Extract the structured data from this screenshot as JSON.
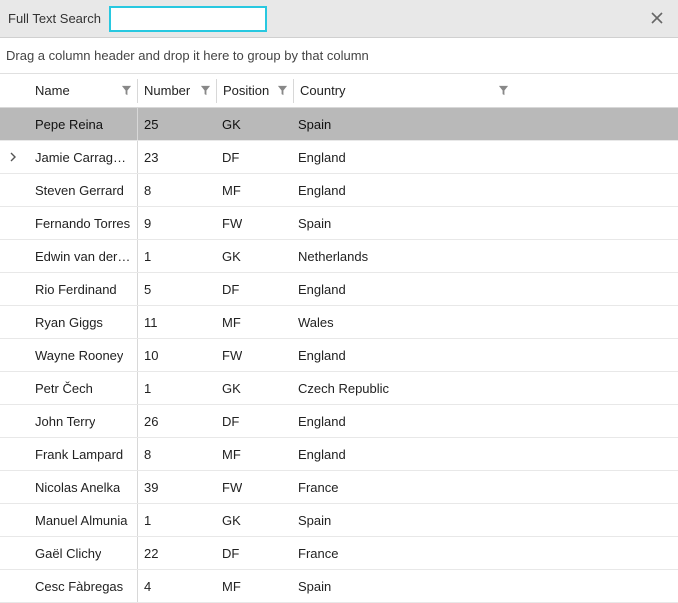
{
  "search": {
    "label": "Full Text Search",
    "value": "",
    "placeholder": ""
  },
  "groupArea": {
    "hint": "Drag a column header and drop it here to group by that column"
  },
  "columns": [
    {
      "key": "name",
      "label": "Name"
    },
    {
      "key": "number",
      "label": "Number"
    },
    {
      "key": "position",
      "label": "Position"
    },
    {
      "key": "country",
      "label": "Country"
    }
  ],
  "rows": [
    {
      "name": "Pepe Reina",
      "number": "25",
      "position": "GK",
      "country": "Spain",
      "selected": true,
      "expandable": false
    },
    {
      "name": "Jamie Carragher",
      "number": "23",
      "position": "DF",
      "country": "England",
      "selected": false,
      "expandable": true
    },
    {
      "name": "Steven Gerrard",
      "number": "8",
      "position": "MF",
      "country": "England",
      "selected": false,
      "expandable": false
    },
    {
      "name": "Fernando Torres",
      "number": "9",
      "position": "FW",
      "country": "Spain",
      "selected": false,
      "expandable": false
    },
    {
      "name": "Edwin van der Sar",
      "number": "1",
      "position": "GK",
      "country": "Netherlands",
      "selected": false,
      "expandable": false
    },
    {
      "name": "Rio Ferdinand",
      "number": "5",
      "position": "DF",
      "country": "England",
      "selected": false,
      "expandable": false
    },
    {
      "name": "Ryan Giggs",
      "number": "11",
      "position": "MF",
      "country": "Wales",
      "selected": false,
      "expandable": false
    },
    {
      "name": "Wayne Rooney",
      "number": "10",
      "position": "FW",
      "country": "England",
      "selected": false,
      "expandable": false
    },
    {
      "name": "Petr Čech",
      "number": "1",
      "position": "GK",
      "country": "Czech Republic",
      "selected": false,
      "expandable": false
    },
    {
      "name": "John Terry",
      "number": "26",
      "position": "DF",
      "country": "England",
      "selected": false,
      "expandable": false
    },
    {
      "name": "Frank Lampard",
      "number": "8",
      "position": "MF",
      "country": "England",
      "selected": false,
      "expandable": false
    },
    {
      "name": "Nicolas Anelka",
      "number": "39",
      "position": "FW",
      "country": "France",
      "selected": false,
      "expandable": false
    },
    {
      "name": "Manuel Almunia",
      "number": "1",
      "position": "GK",
      "country": "Spain",
      "selected": false,
      "expandable": false
    },
    {
      "name": "Gaël Clichy",
      "number": "22",
      "position": "DF",
      "country": "France",
      "selected": false,
      "expandable": false
    },
    {
      "name": "Cesc Fàbregas",
      "number": "4",
      "position": "MF",
      "country": "Spain",
      "selected": false,
      "expandable": false
    }
  ],
  "colors": {
    "accent": "#28c8e0",
    "selectedRow": "#b9b9b9"
  }
}
